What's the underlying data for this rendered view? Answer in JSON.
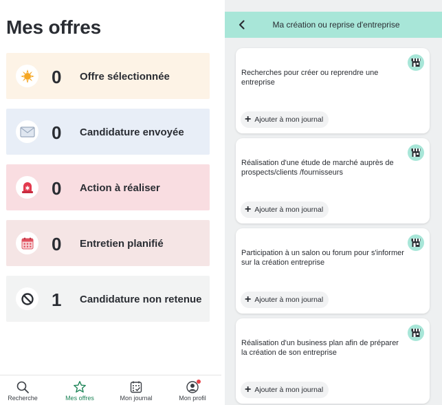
{
  "left": {
    "title": "Mes offres",
    "stats": [
      {
        "count": "0",
        "label": "Offre sélectionnée",
        "icon": "sun-icon",
        "bg": "#fdf3e6"
      },
      {
        "count": "0",
        "label": "Candidature envoyée",
        "icon": "envelope-icon",
        "bg": "#e8eef7"
      },
      {
        "count": "0",
        "label": "Action à réaliser",
        "icon": "siren-icon",
        "bg": "#f9dde1"
      },
      {
        "count": "0",
        "label": "Entretien planifié",
        "icon": "calendar-icon",
        "bg": "#f5e5e5"
      },
      {
        "count": "1",
        "label": "Candidature non retenue",
        "icon": "forbidden-icon",
        "bg": "#f2f3f3"
      }
    ],
    "nav": [
      {
        "label": "Recherche",
        "icon": "search-icon",
        "active": false
      },
      {
        "label": "Mes offres",
        "icon": "star-icon",
        "active": true
      },
      {
        "label": "Mon journal",
        "icon": "journal-icon",
        "active": false
      },
      {
        "label": "Mon profil",
        "icon": "profile-icon",
        "active": false,
        "notification": true
      }
    ]
  },
  "right": {
    "header": {
      "title": "Ma création ou reprise d'entreprise",
      "back_icon": "chevron-left-icon"
    },
    "activities": [
      {
        "text": "Recherches pour créer ou reprendre une entreprise",
        "button": "Ajouter à mon journal",
        "icon": "shop-icon"
      },
      {
        "text": "Réalisation d'une étude de marché auprès de prospects/clients /fournisseurs",
        "button": "Ajouter à mon journal",
        "icon": "shop-icon"
      },
      {
        "text": "Participation à un salon ou forum pour s'informer sur la création entreprise",
        "button": "Ajouter à mon journal",
        "icon": "shop-icon"
      },
      {
        "text": "Réalisation d'un business plan afin de préparer la création de son entreprise",
        "button": "Ajouter à mon journal",
        "icon": "shop-icon"
      }
    ]
  },
  "colors": {
    "accent_green": "#1d8457",
    "header_mint": "#a8e6d8",
    "notification_red": "#e8444a"
  }
}
